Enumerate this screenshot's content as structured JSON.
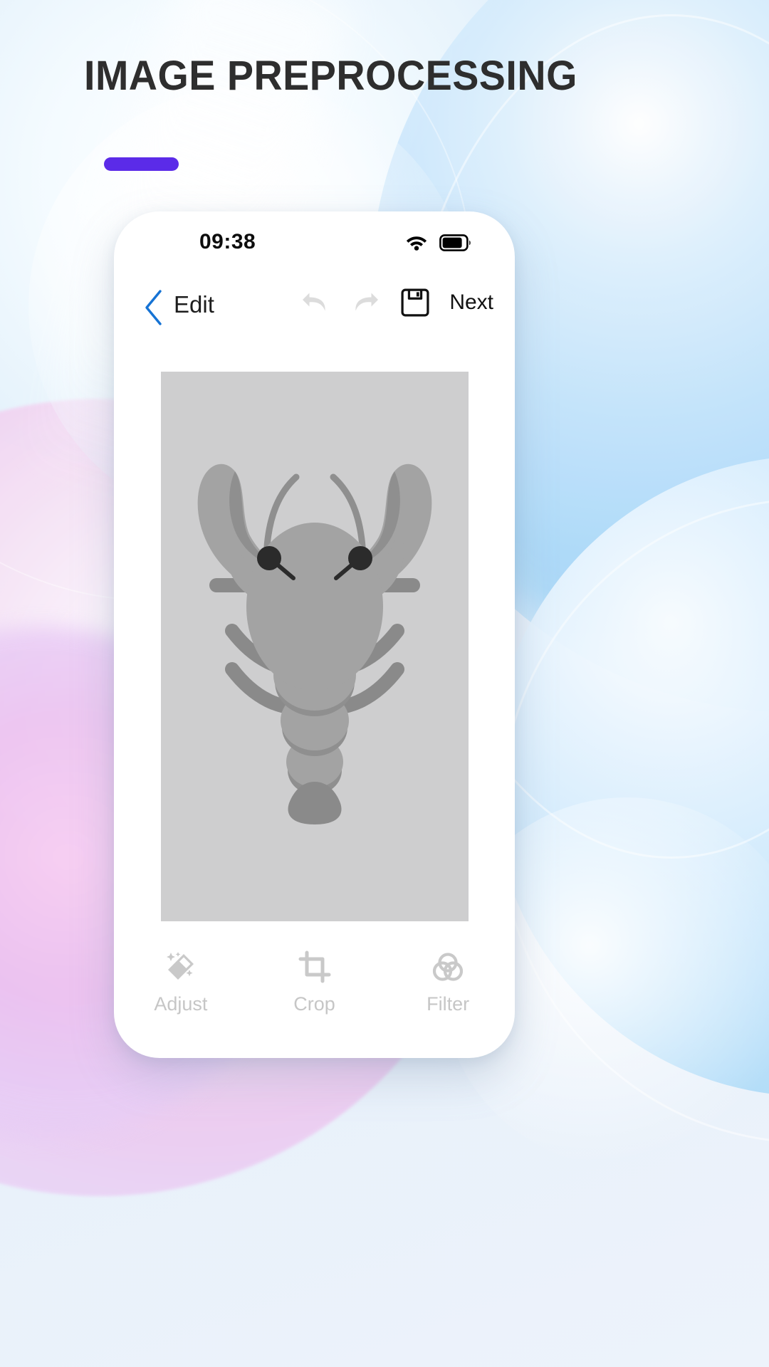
{
  "slide": {
    "title": "IMAGE PREPROCESSING",
    "accent_color": "#5b2be8"
  },
  "phone": {
    "status_bar": {
      "time": "09:38",
      "wifi_icon": "wifi-icon",
      "battery_icon": "battery-icon",
      "battery_level": "75"
    },
    "nav_bar": {
      "back_icon": "chevron-left-icon",
      "title": "Edit",
      "undo_icon": "undo-icon",
      "redo_icon": "redo-icon",
      "save_icon": "save-floppy-icon",
      "next_label": "Next",
      "back_color": "#1673d4",
      "disabled_color": "#dcdcdc"
    },
    "canvas": {
      "image_subject": "lobster",
      "background_color": "#cececf",
      "body_color": "#a3a3a3",
      "shade_color": "#8c8c8c",
      "eye_color": "#2b2b2b"
    },
    "tabs": [
      {
        "label": "Adjust",
        "icon": "magic-wand-icon"
      },
      {
        "label": "Crop",
        "icon": "crop-icon"
      },
      {
        "label": "Filter",
        "icon": "filter-circles-icon"
      }
    ]
  }
}
